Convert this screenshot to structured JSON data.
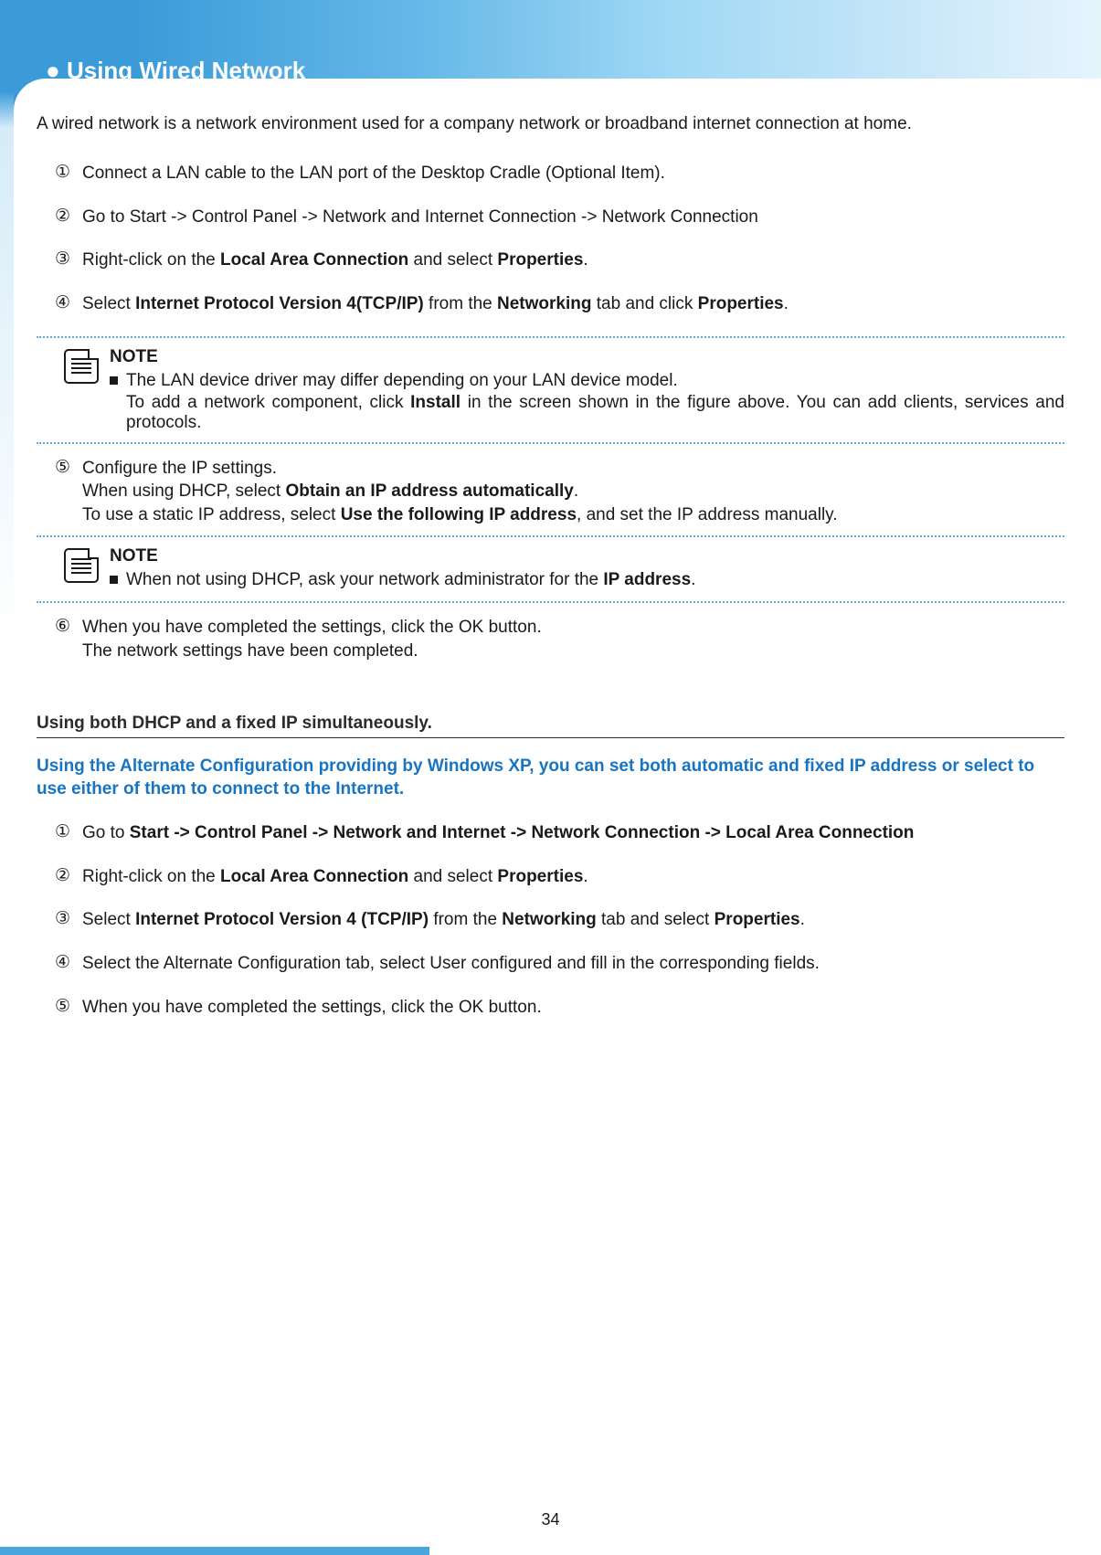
{
  "page_number": "34",
  "header": {
    "bullet": "●",
    "title": "Using Wired Network"
  },
  "intro": "A wired network is a network environment used for a company network or broadband internet connection at home.",
  "steps": {
    "m1": "①",
    "t1": "Connect a LAN cable to the LAN port of the Desktop Cradle (Optional Item).",
    "m2": "②",
    "t2": "Go to Start -> Control Panel -> Network and Internet Connection -> Network Connection",
    "m3": "③",
    "t3a": "Right-click on the ",
    "t3b": "Local Area Connection",
    "t3c": " and select ",
    "t3d": "Properties",
    "t3e": ".",
    "m4": "④",
    "t4a": "Select ",
    "t4b": "Internet Protocol Version 4(TCP/IP)",
    "t4c": " from the ",
    "t4d": "Networking",
    "t4e": " tab and click ",
    "t4f": "Properties",
    "t4g": ".",
    "m5": "⑤",
    "t5a": "Configure the IP settings.",
    "t5b_pre": "When using DHCP, select ",
    "t5b_bold": "Obtain an IP address automatically",
    "t5b_post": ".",
    "t5c_pre": "To use a static IP address, select ",
    "t5c_bold": "Use the following IP address",
    "t5c_post": ", and set the IP address manually.",
    "m6": "⑥",
    "t6a": "When you have completed the settings, click the OK button.",
    "t6b": "The network settings have been completed."
  },
  "note1": {
    "label": "NOTE",
    "line1": "The LAN device driver may differ depending on your LAN device model.",
    "line2_pre": "To add a network component, click ",
    "line2_bold": "Install",
    "line2_post": " in the screen shown in the figure above. You can add clients, services and protocols."
  },
  "note2": {
    "label": "NOTE",
    "line1_pre": "When not using DHCP, ask your network administrator for the ",
    "line1_bold": "IP address",
    "line1_post": "."
  },
  "section2": {
    "heading": "Using both DHCP and a fixed IP simultaneously.",
    "intro": "Using the Alternate Configuration providing by Windows XP, you can set both automatic and fixed IP address or select to use either of them to connect to the Internet.",
    "m1": "①",
    "s1_pre": "Go to ",
    "s1_bold": "Start -> Control Panel -> Network and Internet -> Network Connection -> Local Area Connection",
    "m2": "②",
    "s2_pre": "Right-click on the ",
    "s2_b1": "Local Area Connection",
    "s2_mid": " and select ",
    "s2_b2": "Properties",
    "s2_post": ".",
    "m3": "③",
    "s3_pre": "Select ",
    "s3_b1": "Internet Protocol Version 4 (TCP/IP)",
    "s3_mid": " from the ",
    "s3_b2": "Networking",
    "s3_mid2": " tab and select ",
    "s3_b3": "Properties",
    "s3_post": ".",
    "m4": "④",
    "s4": "Select the Alternate Configuration tab, select User configured and fill in the corresponding fields.",
    "m5": "⑤",
    "s5": "When you have completed the settings, click the OK button."
  }
}
